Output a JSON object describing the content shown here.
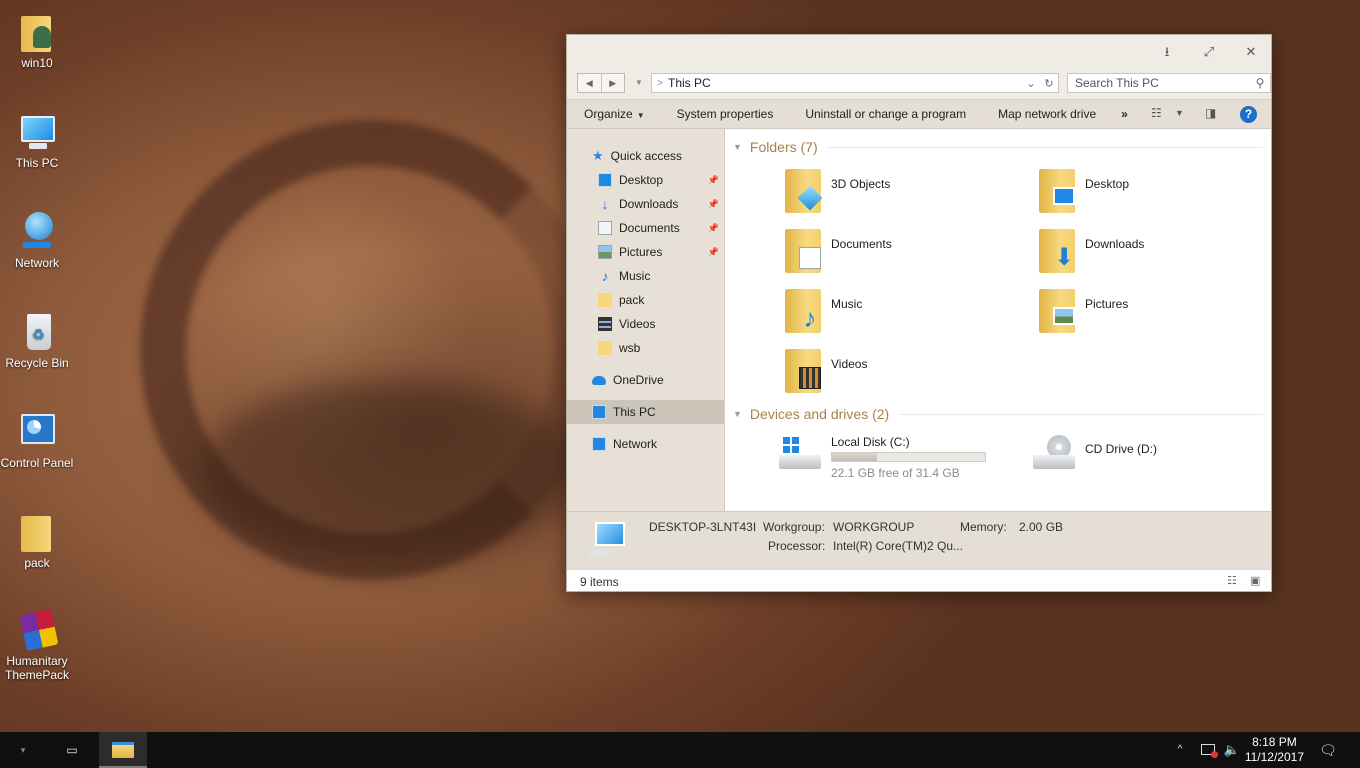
{
  "desktop": {
    "icons": [
      {
        "label": "win10",
        "icon": "user-folder-icon"
      },
      {
        "label": "This PC",
        "icon": "this-pc-icon"
      },
      {
        "label": "Network",
        "icon": "network-globe-icon"
      },
      {
        "label": "Recycle Bin",
        "icon": "recycle-bin-icon"
      },
      {
        "label": "Control Panel",
        "icon": "control-panel-icon"
      },
      {
        "label": "pack",
        "icon": "folder-icon"
      },
      {
        "label": "Humanitary ThemePack",
        "icon": "themepack-icon"
      }
    ]
  },
  "window": {
    "title_buttons": {
      "minimize": "⭳",
      "maximize": "⤢",
      "close": "✕"
    },
    "address": {
      "path": "This PC"
    },
    "search": {
      "placeholder": "Search This PC"
    },
    "commands": {
      "organize": "Organize",
      "system_properties": "System properties",
      "uninstall": "Uninstall or change a program",
      "map_drive": "Map network drive",
      "more": "»"
    },
    "nav": {
      "quick_access": "Quick access",
      "items": [
        {
          "label": "Desktop",
          "pinned": true
        },
        {
          "label": "Downloads",
          "pinned": true
        },
        {
          "label": "Documents",
          "pinned": true
        },
        {
          "label": "Pictures",
          "pinned": true
        },
        {
          "label": "Music",
          "pinned": false
        },
        {
          "label": "pack",
          "pinned": false
        },
        {
          "label": "Videos",
          "pinned": false
        },
        {
          "label": "wsb",
          "pinned": false
        }
      ],
      "onedrive": "OneDrive",
      "this_pc": "This PC",
      "network": "Network"
    },
    "folders": {
      "heading": "Folders (7)",
      "items": [
        "3D Objects",
        "Desktop",
        "Documents",
        "Downloads",
        "Music",
        "Pictures",
        "Videos"
      ]
    },
    "drives": {
      "heading": "Devices and drives (2)",
      "local": {
        "name": "Local Disk (C:)",
        "free_text": "22.1 GB free of 31.4 GB",
        "used_fraction": 0.296
      },
      "cd": {
        "name": "CD Drive (D:)"
      }
    },
    "details": {
      "computer_name": "DESKTOP-3LNT43I",
      "workgroup_label": "Workgroup:",
      "workgroup_value": "WORKGROUP",
      "memory_label": "Memory:",
      "memory_value": "2.00 GB",
      "processor_label": "Processor:",
      "processor_value": "Intel(R) Core(TM)2 Qu..."
    },
    "status": {
      "count": "9 items"
    }
  },
  "taskbar": {
    "time": "8:18 PM",
    "date": "11/12/2017"
  }
}
